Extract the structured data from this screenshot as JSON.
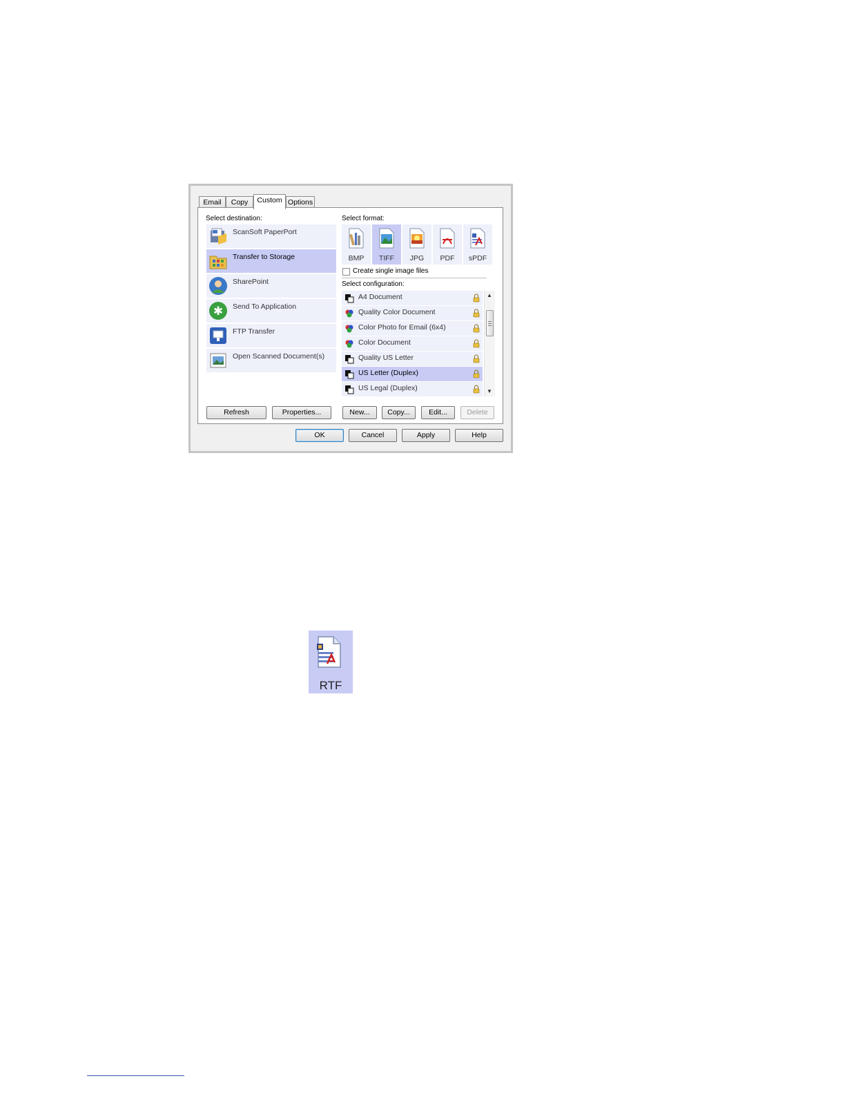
{
  "tabs": [
    {
      "label": "Email"
    },
    {
      "label": "Copy"
    },
    {
      "label": "Custom",
      "active": true
    },
    {
      "label": "Options"
    }
  ],
  "destination": {
    "label": "Select destination:",
    "items": [
      {
        "label": "ScanSoft PaperPort",
        "icon": "paperport-icon"
      },
      {
        "label": "Transfer to Storage",
        "icon": "storage-folder-icon",
        "selected": true
      },
      {
        "label": "SharePoint",
        "icon": "sharepoint-user-icon"
      },
      {
        "label": "Send To Application",
        "icon": "send-to-application-icon"
      },
      {
        "label": "FTP Transfer",
        "icon": "ftp-icon"
      },
      {
        "label": "Open Scanned Document(s)",
        "icon": "open-document-icon"
      }
    ]
  },
  "format": {
    "label": "Select format:",
    "items": [
      {
        "label": "BMP",
        "icon": "bmp-file-icon"
      },
      {
        "label": "TIFF",
        "icon": "tiff-file-icon",
        "selected": true
      },
      {
        "label": "JPG",
        "icon": "jpg-file-icon"
      },
      {
        "label": "PDF",
        "icon": "pdf-file-icon"
      },
      {
        "label": "sPDF",
        "icon": "spdf-file-icon"
      }
    ],
    "single_image_label": "Create single image files",
    "single_image_checked": false
  },
  "configuration": {
    "label": "Select configuration:",
    "items": [
      {
        "label": "A4 Document",
        "color": false
      },
      {
        "label": "Quality Color Document",
        "color": true
      },
      {
        "label": "Color Photo for Email (6x4)",
        "color": true
      },
      {
        "label": "Color Document",
        "color": true
      },
      {
        "label": "Quality US Letter",
        "color": false
      },
      {
        "label": "US Letter (Duplex)",
        "color": false,
        "selected": true
      },
      {
        "label": "US Legal (Duplex)",
        "color": false
      }
    ]
  },
  "buttons": {
    "refresh": "Refresh",
    "properties": "Properties...",
    "new": "New...",
    "copy": "Copy...",
    "edit": "Edit...",
    "delete": "Delete",
    "ok": "OK",
    "cancel": "Cancel",
    "apply": "Apply",
    "help": "Help"
  },
  "rtf_icon": {
    "label": "RTF",
    "icon": "rtf-file-icon"
  },
  "colors": {
    "selected_bg": "#c8ccf5",
    "item_bg": "#eef0fa",
    "lock": "#e8c040"
  }
}
